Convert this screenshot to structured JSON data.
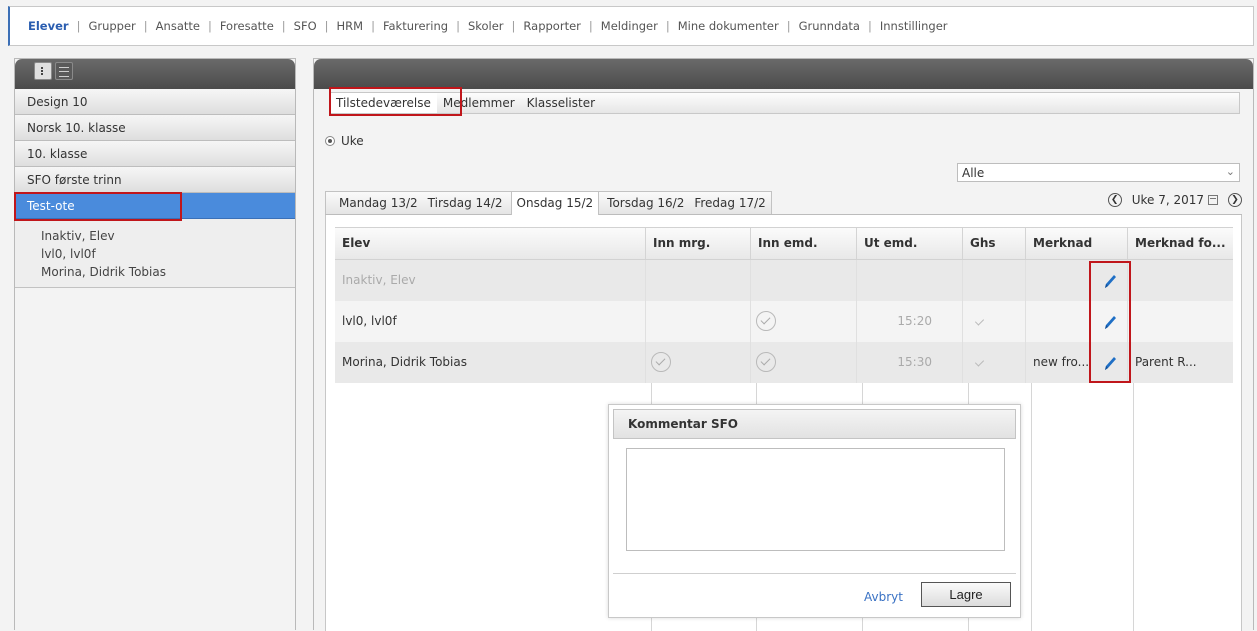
{
  "top_nav": {
    "items": [
      {
        "label": "Elever",
        "active": true
      },
      {
        "label": "Grupper"
      },
      {
        "label": "Ansatte"
      },
      {
        "label": "Foresatte"
      },
      {
        "label": "SFO"
      },
      {
        "label": "HRM"
      },
      {
        "label": "Fakturering"
      },
      {
        "label": "Skoler"
      },
      {
        "label": "Rapporter"
      },
      {
        "label": "Meldinger"
      },
      {
        "label": "Mine dokumenter"
      },
      {
        "label": "Grunndata"
      },
      {
        "label": "Innstillinger"
      }
    ]
  },
  "sidebar": {
    "groups": [
      {
        "label": "Design 10"
      },
      {
        "label": "Norsk 10. klasse"
      },
      {
        "label": "10. klasse"
      },
      {
        "label": "SFO første trinn"
      },
      {
        "label": "Test-ote",
        "selected": true
      }
    ],
    "students": [
      {
        "label": "Inaktiv, Elev"
      },
      {
        "label": "lvl0, lvl0f"
      },
      {
        "label": "Morina, Didrik Tobias"
      }
    ]
  },
  "main": {
    "tabs": [
      {
        "label": "Tilstedeværelse",
        "active": true
      },
      {
        "label": "Medlemmer"
      },
      {
        "label": "Klasselister"
      }
    ],
    "radio_label": "Uke",
    "filter_select_value": "Alle",
    "day_tabs": [
      {
        "label": "Mandag 13/2"
      },
      {
        "label": "Tirsdag 14/2"
      },
      {
        "label": "Onsdag 15/2",
        "active": true
      },
      {
        "label": "Torsdag 16/2"
      },
      {
        "label": "Fredag 17/2"
      }
    ],
    "week_label": "Uke 7, 2017"
  },
  "table": {
    "headers": [
      "Elev",
      "Inn mrg.",
      "Inn emd.",
      "Ut emd.",
      "Ghs",
      "Merknad",
      "Merknad fo..."
    ],
    "rows": [
      {
        "elev": "Inaktiv, Elev",
        "inn_mrg": false,
        "inn_emd": false,
        "ut_emd": "",
        "ghs": false,
        "merknad": "",
        "merknad_fo": "",
        "inactive": true
      },
      {
        "elev": "lvl0, lvl0f",
        "inn_mrg": false,
        "inn_emd": true,
        "ut_emd": "15:20",
        "ghs": true,
        "merknad": "",
        "merknad_fo": ""
      },
      {
        "elev": "Morina, Didrik Tobias",
        "inn_mrg": true,
        "inn_emd": true,
        "ut_emd": "15:30",
        "ghs": true,
        "merknad": "new fro...",
        "merknad_fo": "Parent R..."
      }
    ]
  },
  "dialog": {
    "title": "Kommentar SFO",
    "textarea_value": "",
    "cancel_label": "Avbryt",
    "save_label": "Lagre"
  },
  "colors": {
    "accent": "#4a8bdc",
    "highlight": "#c0161b",
    "pencil": "#1f6fc5"
  }
}
